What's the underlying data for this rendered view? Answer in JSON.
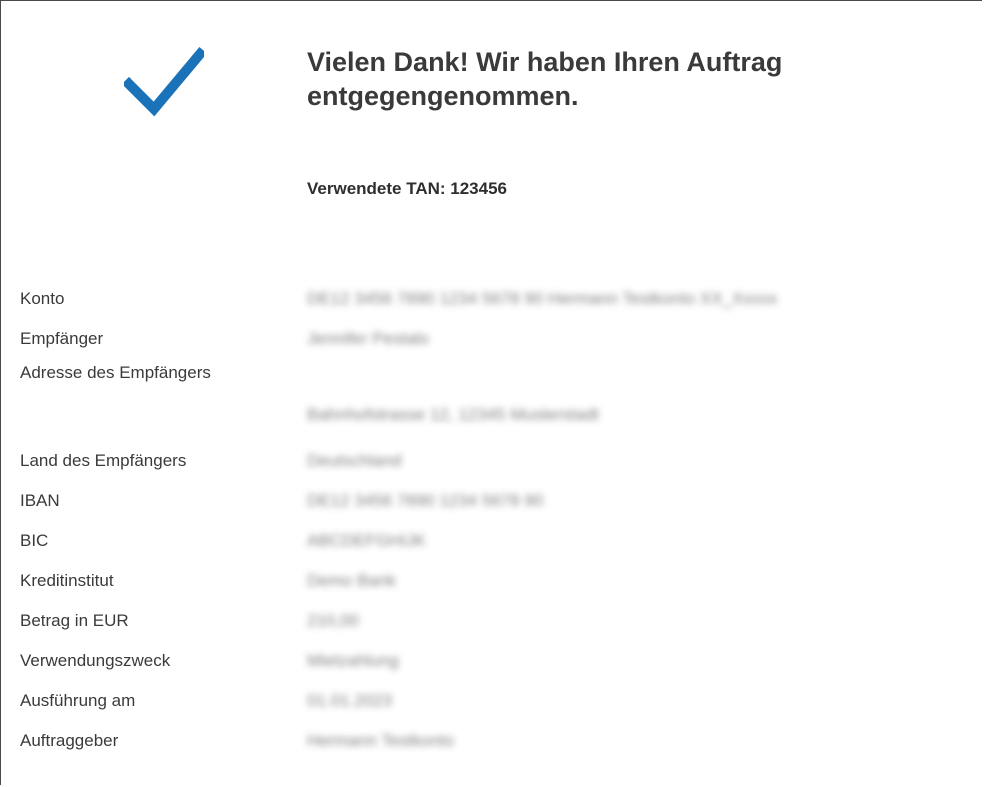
{
  "confirmation": {
    "title": "Vielen Dank! Wir haben Ihren Auftrag entgegengenommen.",
    "tan_label": "Verwendete TAN: 123456",
    "icon": "checkmark-icon",
    "accent_color": "#1a73b8"
  },
  "details": [
    {
      "label": "Konto",
      "value": "DE12 3456 7890 1234 5678 90 Hermann Testkonto XX_Xxxxx"
    },
    {
      "label": "Empfänger",
      "value": "Jennifer Pestalo"
    },
    {
      "label": "Adresse des Empfängers",
      "value": "Bahnhofstrasse 12, 12345 Musterstadt"
    },
    {
      "label": "Land des Empfängers",
      "value": "Deutschland"
    },
    {
      "label": "IBAN",
      "value": "DE12 3456 7890 1234 5678 90"
    },
    {
      "label": "BIC",
      "value": "ABCDEFGHIJK"
    },
    {
      "label": "Kreditinstitut",
      "value": "Demo Bank"
    },
    {
      "label": "Betrag in EUR",
      "value": "210,00"
    },
    {
      "label": "Verwendungszweck",
      "value": "Mietzahlung"
    },
    {
      "label": "Ausführung am",
      "value": "01.01.2023"
    },
    {
      "label": "Auftraggeber",
      "value": "Hermann Testkonto"
    }
  ]
}
